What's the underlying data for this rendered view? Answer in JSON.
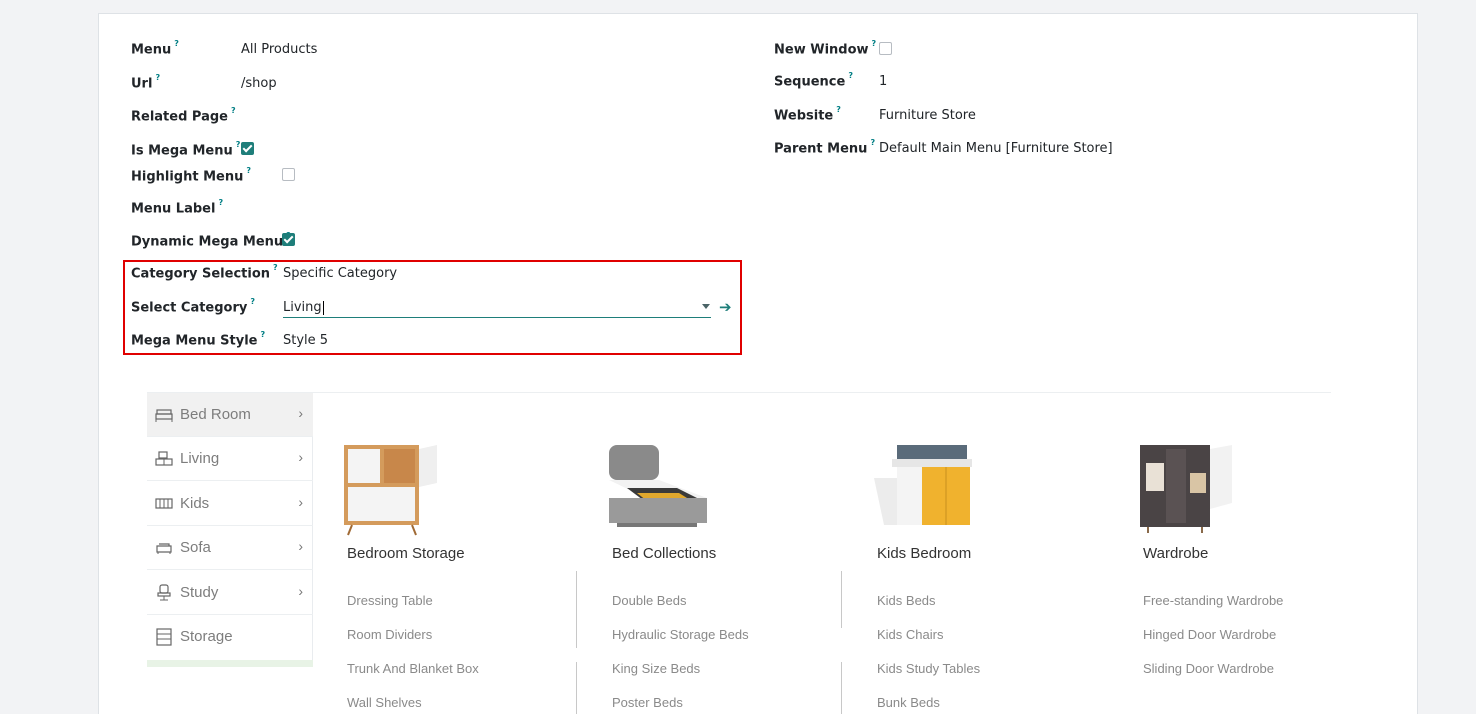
{
  "form": {
    "menu_label": "Menu",
    "menu_value": "All Products",
    "url_label": "Url",
    "url_value": "/shop",
    "related_page_label": "Related Page",
    "is_mega_menu_label": "Is Mega Menu",
    "is_mega_menu_checked": true,
    "highlight_menu_label": "Highlight Menu",
    "highlight_menu_checked": false,
    "menu_label_label": "Menu Label",
    "dynamic_mega_menu_label": "Dynamic Mega Menu",
    "dynamic_mega_menu_checked": true,
    "category_selection_label": "Category Selection",
    "category_selection_value": "Specific Category",
    "select_category_label": "Select Category",
    "select_category_value": "Living",
    "mega_menu_style_label": "Mega Menu Style",
    "mega_menu_style_value": "Style 5",
    "new_window_label": "New Window",
    "new_window_checked": false,
    "sequence_label": "Sequence",
    "sequence_value": "1",
    "website_label": "Website",
    "website_value": "Furniture Store",
    "parent_menu_label": "Parent Menu",
    "parent_menu_value": "Default Main Menu [Furniture Store]",
    "help_mark": "?"
  },
  "preview": {
    "sidebar": [
      {
        "label": "Bed Room",
        "icon": "bed-icon"
      },
      {
        "label": "Living",
        "icon": "living-icon"
      },
      {
        "label": "Kids",
        "icon": "crib-icon"
      },
      {
        "label": "Sofa",
        "icon": "sofa-icon"
      },
      {
        "label": "Study",
        "icon": "chair-icon"
      },
      {
        "label": "Storage",
        "icon": "cabinet-icon"
      }
    ],
    "chevron": "›",
    "columns": [
      {
        "title": "Bedroom Storage",
        "links": [
          "Dressing Table",
          "Room Dividers",
          "Trunk And Blanket Box",
          "Wall Shelves"
        ]
      },
      {
        "title": "Bed Collections",
        "links": [
          "Double Beds",
          "Hydraulic Storage Beds",
          "King Size Beds",
          "Poster Beds"
        ]
      },
      {
        "title": "Kids Bedroom",
        "links": [
          "Kids Beds",
          "Kids Chairs",
          "Kids Study Tables",
          "Bunk Beds"
        ]
      },
      {
        "title": "Wardrobe",
        "links": [
          "Free-standing Wardrobe",
          "Hinged Door Wardrobe",
          "Sliding Door Wardrobe"
        ]
      }
    ]
  },
  "colors": {
    "accent": "#1e7e7a",
    "highlight_border": "#e00000"
  }
}
